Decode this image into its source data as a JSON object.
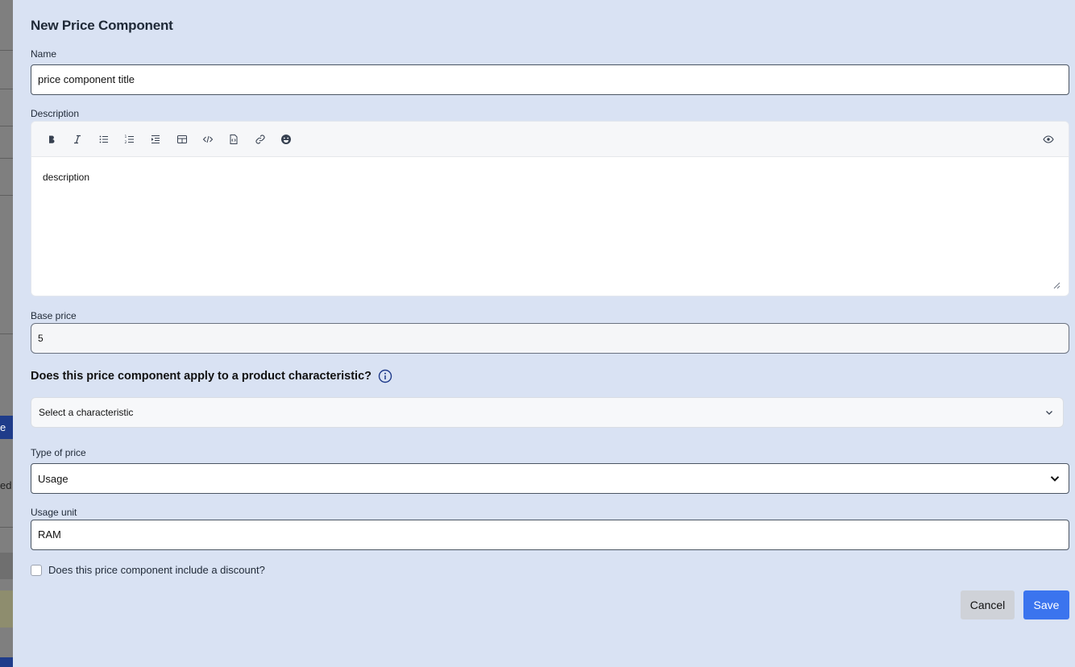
{
  "background": {
    "blue_tab_text": "e",
    "side_text": "ed"
  },
  "modal": {
    "title": "New Price Component",
    "name": {
      "label": "Name",
      "value": "price component title"
    },
    "description": {
      "label": "Description",
      "value": "description",
      "toolbar": [
        "bold-icon",
        "italic-icon",
        "bullet-list-icon",
        "numbered-list-icon",
        "indent-icon",
        "table-icon",
        "code-icon",
        "code-block-icon",
        "link-icon",
        "emoji-icon",
        "preview-eye-icon"
      ]
    },
    "base_price": {
      "label": "Base price",
      "value": "5"
    },
    "characteristic": {
      "question": "Does this price component apply to a product characteristic?",
      "selected": "Select a characteristic"
    },
    "type_of_price": {
      "label": "Type of price",
      "selected": "Usage"
    },
    "usage_unit": {
      "label": "Usage unit",
      "value": "RAM"
    },
    "discount_checkbox": {
      "label": "Does this price component include a discount?",
      "checked": false
    },
    "buttons": {
      "cancel": "Cancel",
      "save": "Save"
    },
    "colors": {
      "panel_bg": "#d9e2f3",
      "primary": "#3b74ee",
      "cancel_bg": "#cfd2d8"
    }
  }
}
